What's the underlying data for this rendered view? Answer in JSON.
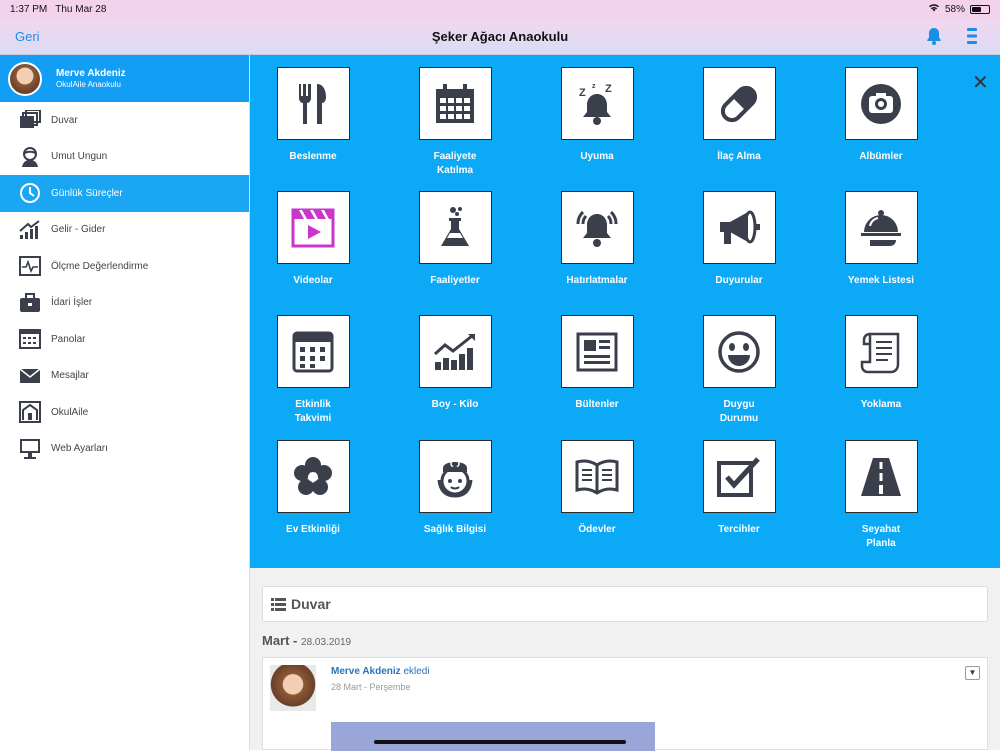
{
  "status": {
    "time": "1:37 PM",
    "date": "Thu Mar 28",
    "battery": "58%",
    "battery_level": 0.58
  },
  "header": {
    "back_label": "Geri",
    "title": "Şeker Ağacı Anaokulu"
  },
  "profile": {
    "name": "Merve Akdeniz",
    "org": "OkulAile Anaokulu"
  },
  "sidebar": {
    "items": [
      {
        "label": "Duvar",
        "icon": "wall-icon"
      },
      {
        "label": "Umut Ungun",
        "icon": "child-icon"
      },
      {
        "label": "Günlük Süreçler",
        "icon": "clock-icon",
        "active": true
      },
      {
        "label": "Gelir - Gider",
        "icon": "chart-up-icon"
      },
      {
        "label": "Ölçme Değerlendirme",
        "icon": "pulse-icon"
      },
      {
        "label": "İdari İşler",
        "icon": "briefcase-icon"
      },
      {
        "label": "Panolar",
        "icon": "board-icon"
      },
      {
        "label": "Mesajlar",
        "icon": "mail-icon"
      },
      {
        "label": "OkulAile",
        "icon": "school-icon"
      },
      {
        "label": "Web Ayarları",
        "icon": "monitor-icon"
      }
    ]
  },
  "tiles": [
    {
      "label": "Beslenme",
      "icon": "utensils-icon"
    },
    {
      "label": "Faaliyete\nKatılma",
      "icon": "calendar-icon"
    },
    {
      "label": "Uyuma",
      "icon": "sleep-bell-icon"
    },
    {
      "label": "İlaç Alma",
      "icon": "pill-icon"
    },
    {
      "label": "Albümler",
      "icon": "camera-icon"
    },
    {
      "label": "Videolar",
      "icon": "video-icon"
    },
    {
      "label": "Faaliyetler",
      "icon": "flask-icon"
    },
    {
      "label": "Hatırlatmalar",
      "icon": "ringing-bell-icon"
    },
    {
      "label": "Duyurular",
      "icon": "megaphone-icon"
    },
    {
      "label": "Yemek Listesi",
      "icon": "cloche-icon"
    },
    {
      "label": "Etkinlik\nTakvimi",
      "icon": "calendar-grid-icon"
    },
    {
      "label": "Boy - Kilo",
      "icon": "growth-chart-icon"
    },
    {
      "label": "Bültenler",
      "icon": "newspaper-icon"
    },
    {
      "label": "Duygu\nDurumu",
      "icon": "smiley-icon"
    },
    {
      "label": "Yoklama",
      "icon": "scroll-icon"
    },
    {
      "label": "Ev Etkinliği",
      "icon": "flower-icon"
    },
    {
      "label": "Sağlık Bilgisi",
      "icon": "nurse-icon"
    },
    {
      "label": "Ödevler",
      "icon": "book-icon"
    },
    {
      "label": "Tercihler",
      "icon": "checkbox-icon"
    },
    {
      "label": "Seyahat\nPlanla",
      "icon": "road-icon"
    }
  ],
  "feed": {
    "section_title": "Duvar",
    "month": "Mart -",
    "date": "28.03.2019",
    "post": {
      "author": "Merve Akdeniz",
      "action": "ekledi",
      "date": "28 Mart - Perşembe"
    }
  },
  "colors": {
    "accent": "#139ef6",
    "panel": "#0ba9f6",
    "icon_dark": "#3a3f4b",
    "video_accent": "#c936c9"
  }
}
